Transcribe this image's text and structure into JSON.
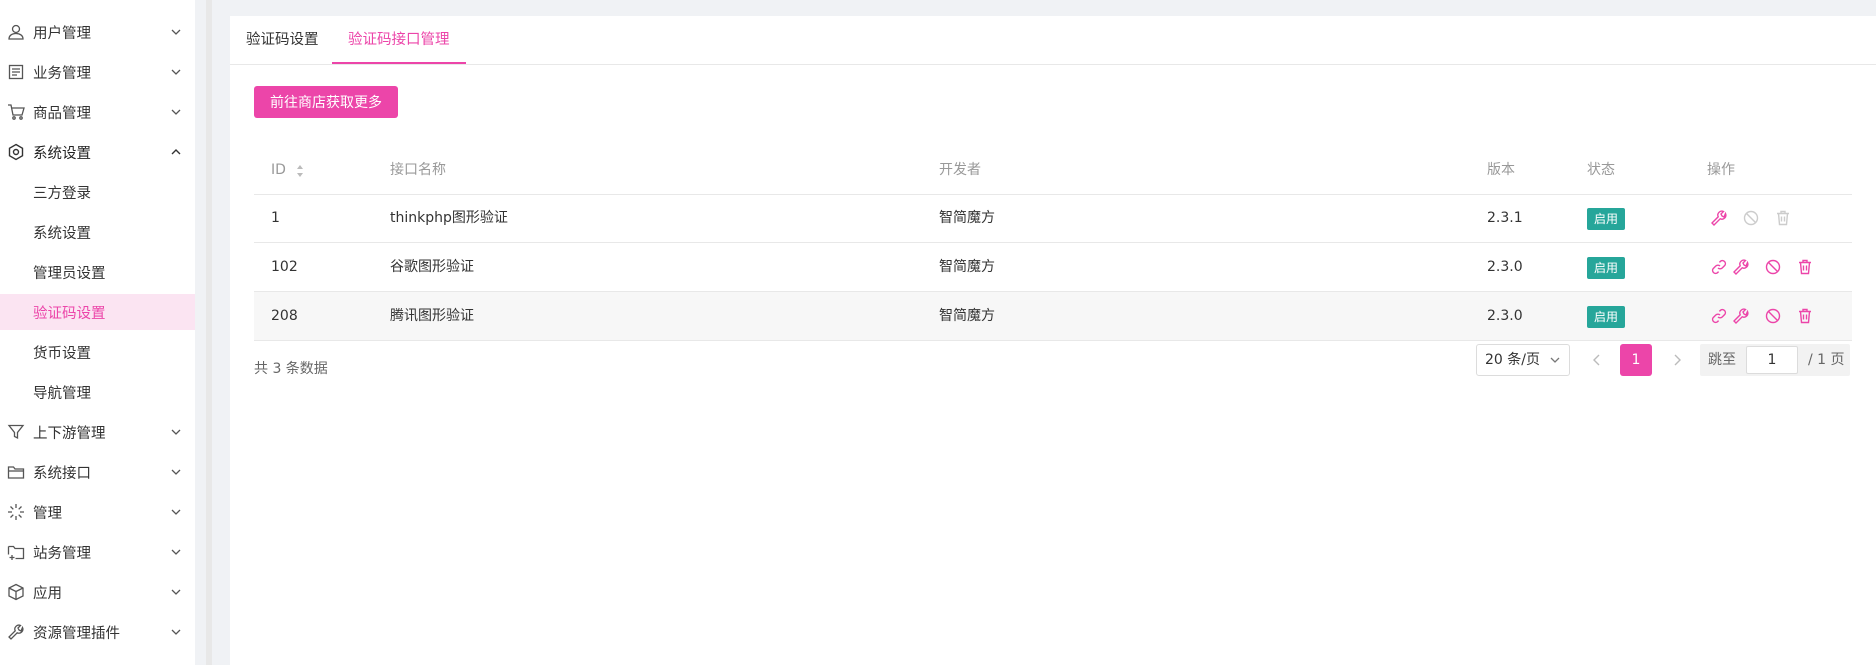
{
  "sidebar": {
    "items": [
      {
        "label": "用户管理",
        "icon": "user-icon",
        "expanded": false
      },
      {
        "label": "业务管理",
        "icon": "document-icon",
        "expanded": false
      },
      {
        "label": "商品管理",
        "icon": "cart-icon",
        "expanded": false
      },
      {
        "label": "系统设置",
        "icon": "hexagon-settings-icon",
        "expanded": true
      },
      {
        "label": "上下游管理",
        "icon": "filter-icon",
        "expanded": false
      },
      {
        "label": "系统接口",
        "icon": "folder-icon",
        "expanded": false
      },
      {
        "label": "管理",
        "icon": "sparkle-icon",
        "expanded": false
      },
      {
        "label": "站务管理",
        "icon": "folder-plus-icon",
        "expanded": false
      },
      {
        "label": "应用",
        "icon": "box-icon",
        "expanded": false
      },
      {
        "label": "资源管理插件",
        "icon": "wrench-icon",
        "expanded": false
      }
    ],
    "sub_items": [
      {
        "label": "三方登录"
      },
      {
        "label": "系统设置"
      },
      {
        "label": "管理员设置"
      },
      {
        "label": "验证码设置",
        "active": true
      },
      {
        "label": "货币设置"
      },
      {
        "label": "导航管理"
      }
    ]
  },
  "tabs": [
    {
      "label": "验证码设置",
      "active": false
    },
    {
      "label": "验证码接口管理",
      "active": true
    }
  ],
  "store_button": "前往商店获取更多",
  "table": {
    "headers": {
      "id": "ID",
      "name": "接口名称",
      "developer": "开发者",
      "version": "版本",
      "status": "状态",
      "actions": "操作"
    },
    "rows": [
      {
        "id": "1",
        "name": "thinkphp图形验证",
        "developer": "智简魔方",
        "version": "2.3.1",
        "status": "启用"
      },
      {
        "id": "102",
        "name": "谷歌图形验证",
        "developer": "智简魔方",
        "version": "2.3.0",
        "status": "启用"
      },
      {
        "id": "208",
        "name": "腾讯图形验证",
        "developer": "智简魔方",
        "version": "2.3.0",
        "status": "启用"
      }
    ]
  },
  "pagination": {
    "total": "共 3 条数据",
    "page_size": "20 条/页",
    "current_page": "1",
    "jump_label": "跳至",
    "jump_value": "1",
    "total_pages": "/ 1 页"
  },
  "colors": {
    "accent": "#ec45a9",
    "status_green": "#26a69a",
    "annotation_red": "#e53935"
  }
}
